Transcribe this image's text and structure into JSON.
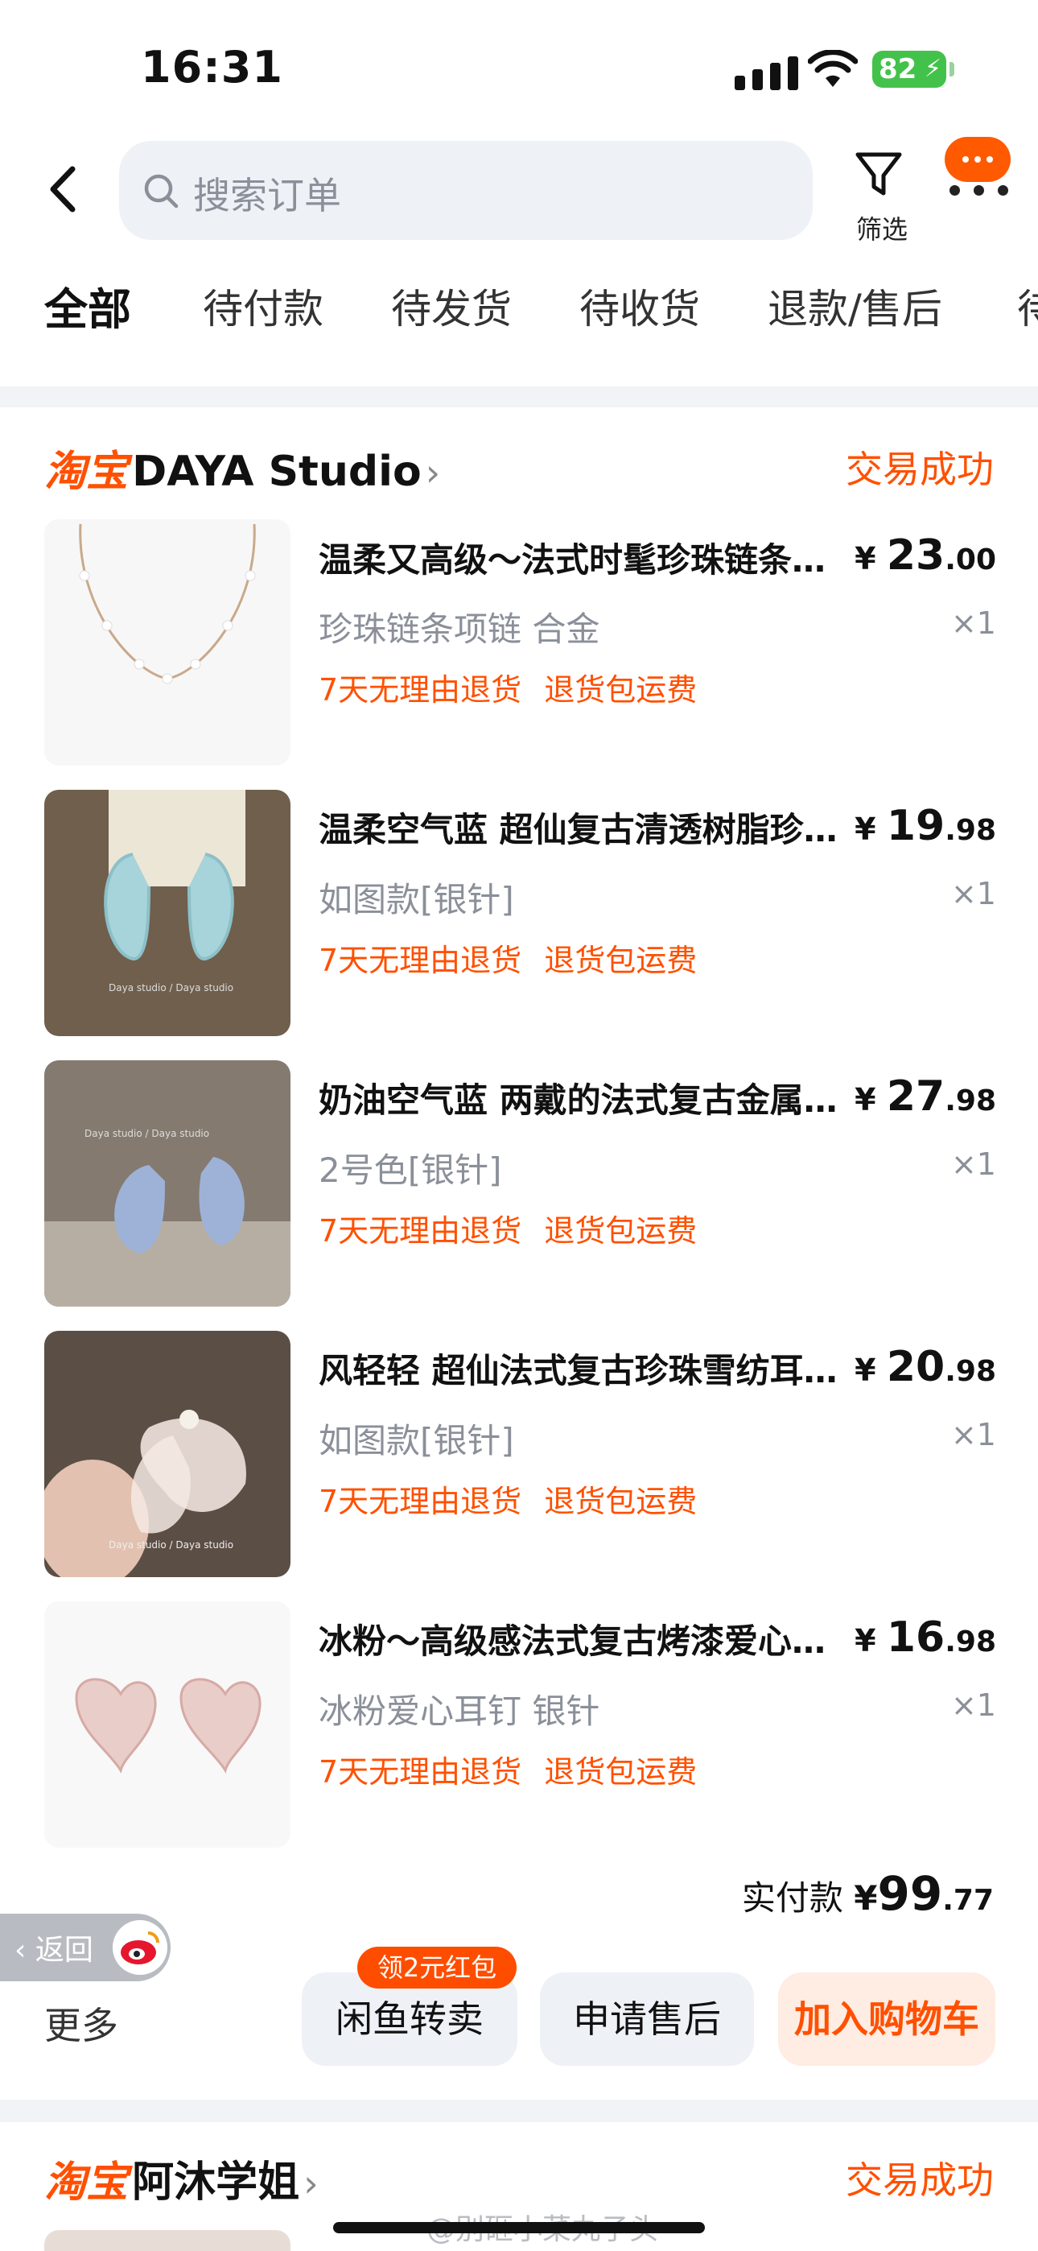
{
  "status_bar": {
    "time": "16:31",
    "battery": "82"
  },
  "header": {
    "search_placeholder": "搜索订单",
    "filter_label": "筛选"
  },
  "tabs": [
    "全部",
    "待付款",
    "待发货",
    "待收货",
    "退款/售后",
    "待"
  ],
  "order1": {
    "platform": "淘宝",
    "shop": "DAYA Studio",
    "status": "交易成功",
    "items": [
      {
        "title": "温柔又高级～法式时髦珍珠链条…",
        "currency": "¥",
        "price_int": "23",
        "price_dec": ".00",
        "spec": "珍珠链条项链 合金",
        "qty": "×1",
        "promo1": "7天无理由退货",
        "promo2": "退货包运费"
      },
      {
        "title": "温柔空气蓝 超仙复古清透树脂珍…",
        "currency": "¥",
        "price_int": "19",
        "price_dec": ".98",
        "spec": "如图款[银针]",
        "qty": "×1",
        "promo1": "7天无理由退货",
        "promo2": "退货包运费"
      },
      {
        "title": "奶油空气蓝 两戴的法式复古金属…",
        "currency": "¥",
        "price_int": "27",
        "price_dec": ".98",
        "spec": "2号色[银针]",
        "qty": "×1",
        "promo1": "7天无理由退货",
        "promo2": "退货包运费"
      },
      {
        "title": "风轻轻 超仙法式复古珍珠雪纺耳…",
        "currency": "¥",
        "price_int": "20",
        "price_dec": ".98",
        "spec": "如图款[银针]",
        "qty": "×1",
        "promo1": "7天无理由退货",
        "promo2": "退货包运费"
      },
      {
        "title": "冰粉～高级感法式复古烤漆爱心…",
        "currency": "¥",
        "price_int": "16",
        "price_dec": ".98",
        "spec": "冰粉爱心耳钉 银针",
        "qty": "×1",
        "promo1": "7天无理由退货",
        "promo2": "退货包运费"
      }
    ],
    "total_label": "实付款",
    "total_currency": "¥",
    "total_int": "99",
    "total_dec": ".77",
    "more": "更多",
    "btn_resell": "闲鱼转卖",
    "btn_resell_tag": "领2元红包",
    "btn_aftersale": "申请售后",
    "btn_cart": "加入购物车"
  },
  "back_chip": "返回",
  "order2": {
    "platform": "淘宝",
    "shop": "阿沐学姐",
    "status": "交易成功"
  },
  "watermark": "@别砸小菜丸子头"
}
